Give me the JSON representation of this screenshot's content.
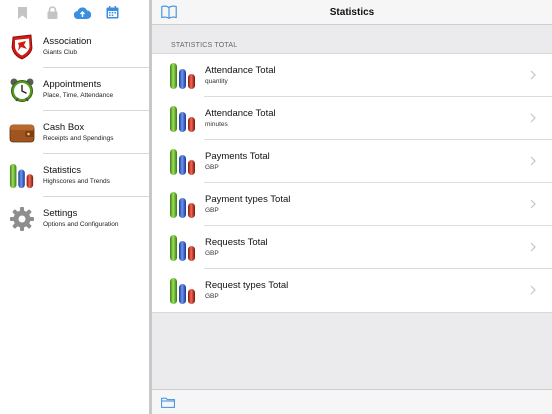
{
  "sidebar": {
    "toolbar": [
      "bookmark-icon",
      "lock-icon",
      "cloud-upload-icon",
      "calendar-icon"
    ],
    "items": [
      {
        "title": "Association",
        "subtitle": "Giants Club",
        "icon": "club-shield-icon"
      },
      {
        "title": "Appointments",
        "subtitle": "Place, Time, Attendance",
        "icon": "alarm-clock-icon"
      },
      {
        "title": "Cash Box",
        "subtitle": "Receipts and Spendings",
        "icon": "wallet-icon"
      },
      {
        "title": "Statistics",
        "subtitle": "Highscores and Trends",
        "icon": "bar-chart-icon"
      },
      {
        "title": "Settings",
        "subtitle": "Options and Configuration",
        "icon": "gear-icon"
      }
    ]
  },
  "main": {
    "title": "Statistics",
    "section_header": "STATISTICS TOTAL",
    "rows": [
      {
        "title": "Attendance Total",
        "subtitle": "quantity"
      },
      {
        "title": "Attendance Total",
        "subtitle": "minutes"
      },
      {
        "title": "Payments Total",
        "subtitle": "GBP"
      },
      {
        "title": "Payment types Total",
        "subtitle": "GBP"
      },
      {
        "title": "Requests Total",
        "subtitle": "GBP"
      },
      {
        "title": "Request types Total",
        "subtitle": "GBP"
      }
    ]
  },
  "colors": {
    "accent": "#3a8fe0",
    "bar_green": "#5da52a",
    "bar_blue": "#2d55c2",
    "bar_red": "#c42a1c"
  }
}
